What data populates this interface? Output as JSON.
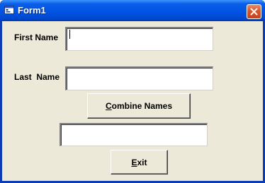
{
  "window": {
    "title": "Form1",
    "icons": {
      "app": "form-app-icon",
      "close": "close-icon"
    },
    "colors": {
      "titlebar": "#0054e3",
      "client": "#ece9d8",
      "close": "#d9542c"
    }
  },
  "form": {
    "first_name_label": "First Name",
    "last_name_label": "Last  Name",
    "first_name_value": "",
    "last_name_value": "",
    "result_value": ""
  },
  "buttons": {
    "combine": {
      "accel": "C",
      "rest": "ombine Names"
    },
    "exit": {
      "accel": "E",
      "rest": "xit"
    }
  }
}
